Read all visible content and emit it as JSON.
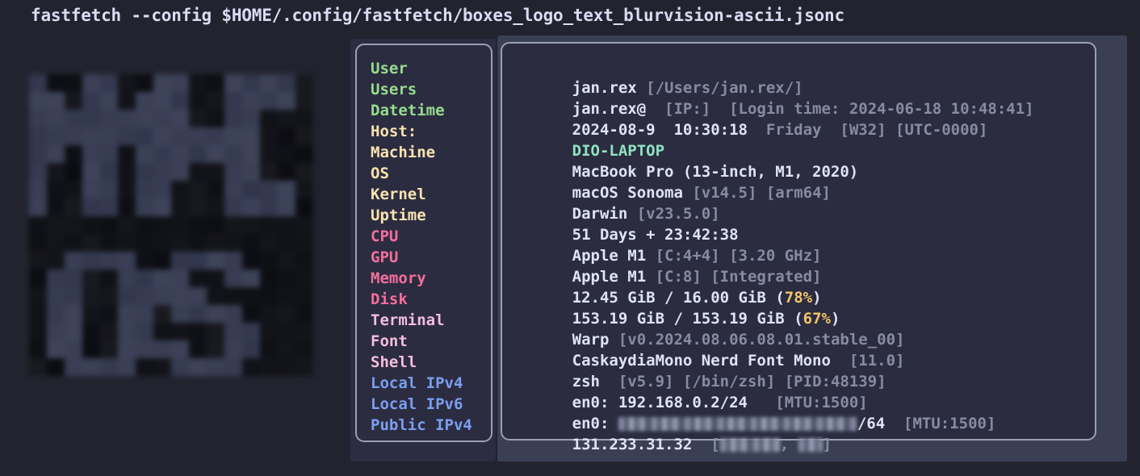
{
  "terminal": {
    "command": "fastfetch --config $HOME/.config/fastfetch/boxes_logo_text_blurvision-ascii.jsonc"
  },
  "colors": {
    "background": "#23232f",
    "panel_background": "#2b2c40",
    "panel_border": "#9ba0b5",
    "values_backdrop": "#3a3f54",
    "labels_backdrop": "#2c2c43",
    "green": "#97dd8e",
    "cream": "#fae3b0",
    "hot_pink": "#f56f9b",
    "pink": "#f5bede",
    "blue": "#7b9ff0",
    "white": "#dfe3f2",
    "dim": "#868ca3",
    "yellow": "#f3c667",
    "mint": "#8fe3c0"
  },
  "logo": {
    "name": "macos-blurvision-ascii-logo",
    "text": "MAC OS"
  },
  "labels": [
    {
      "text": "User",
      "tone": "t-green"
    },
    {
      "text": "Users",
      "tone": "t-green"
    },
    {
      "text": "Datetime",
      "tone": "t-green"
    },
    {
      "text": "Host:",
      "tone": "t-cream"
    },
    {
      "text": "Machine",
      "tone": "t-cream"
    },
    {
      "text": "OS",
      "tone": "t-cream"
    },
    {
      "text": "Kernel",
      "tone": "t-cream"
    },
    {
      "text": "Uptime",
      "tone": "t-cream"
    },
    {
      "text": "CPU",
      "tone": "t-hotpink"
    },
    {
      "text": "GPU",
      "tone": "t-hotpink"
    },
    {
      "text": "Memory",
      "tone": "t-hotpink"
    },
    {
      "text": "Disk",
      "tone": "t-hotpink"
    },
    {
      "text": "Terminal",
      "tone": "t-pink"
    },
    {
      "text": "Font",
      "tone": "t-pink"
    },
    {
      "text": "Shell",
      "tone": "t-pink"
    },
    {
      "text": "Local IPv4",
      "tone": "t-blue"
    },
    {
      "text": "Local IPv6",
      "tone": "t-blue"
    },
    {
      "text": "Public IPv4",
      "tone": "t-blue"
    }
  ],
  "values": {
    "user": {
      "main": "jan.rex",
      "detail": " [/Users/jan.rex/]"
    },
    "users": {
      "main": "jan.rex@",
      "detail": "  [IP:]  [Login time: 2024-06-18 10:48:41]"
    },
    "datetime": {
      "main": "2024-08-9  10:30:18",
      "detail": "  Friday",
      "detail2": "  [W32] [UTC-0000]"
    },
    "host": {
      "main": "DIO-LAPTOP"
    },
    "machine": {
      "main": "MacBook Pro (13-inch, M1, 2020)"
    },
    "os": {
      "main": "macOS Sonoma",
      "detail": " [v14.5] [arm64]"
    },
    "kernel": {
      "main": "Darwin",
      "detail": " [v23.5.0]"
    },
    "uptime": {
      "main": "51 Days + 23:42:38"
    },
    "cpu": {
      "main": "Apple M1",
      "detail": " [C:4+4] [3.20 GHz]"
    },
    "gpu": {
      "main": "Apple M1",
      "detail": " [C:8] [Integrated]"
    },
    "memory": {
      "main": "12.45 GiB / 16.00 GiB ",
      "open": "(",
      "pct": "78%",
      "close": ")"
    },
    "disk": {
      "main": "153.19 GiB / 153.19 GiB ",
      "open": "(",
      "pct": "67%",
      "close": ")"
    },
    "terminal": {
      "main": "Warp",
      "detail": " [v0.2024.08.06.08.01.stable_00]"
    },
    "font": {
      "main": "CaskaydiaMono Nerd Font Mono",
      "detail": "  [11.0]"
    },
    "shell": {
      "main": "zsh",
      "detail": "  [v5.9] [/bin/zsh] [PID:48139]"
    },
    "local_ipv4": {
      "main": "en0: 192.168.0.2/24",
      "detail": "   [MTU:1500]"
    },
    "local_ipv6": {
      "main": "en0: ",
      "suffix": "/64",
      "detail": "  [MTU:1500]",
      "redacted": true
    },
    "public_ipv4": {
      "main": "131.233.31.32",
      "open": "  [",
      "sep": ", ",
      "close": "]",
      "redacted": true
    }
  }
}
